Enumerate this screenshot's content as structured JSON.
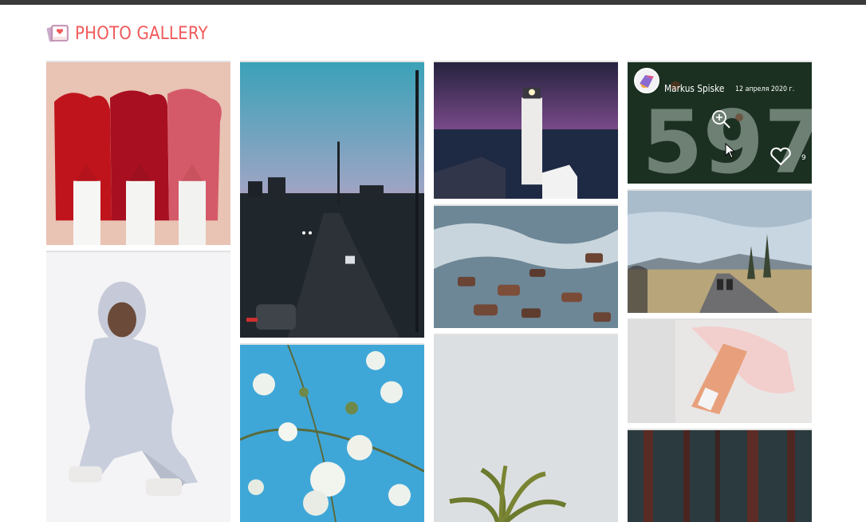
{
  "app": {
    "title": "PHOTO GALLERY",
    "logo_icon": "photo-gallery-logo-icon",
    "accent_color": "#f1595b"
  },
  "gallery": {
    "photos": [
      {
        "subject": "lipstick",
        "column": 1
      },
      {
        "subject": "man-in-grey-tracksuit",
        "column": 1
      },
      {
        "subject": "city-highway-sunset",
        "column": 2
      },
      {
        "subject": "white-blossoms",
        "column": 2
      },
      {
        "subject": "lighthouse-night",
        "column": 3
      },
      {
        "subject": "rocks-in-water",
        "column": 3
      },
      {
        "subject": "palm-tree",
        "column": 3
      },
      {
        "subject": "number-597-wall",
        "column": 4,
        "hovered": true
      },
      {
        "subject": "motorcycles-road",
        "column": 4
      },
      {
        "subject": "skincare-bottle",
        "column": 4
      },
      {
        "subject": "forest-trees",
        "column": 4
      }
    ],
    "hover_overlay": {
      "author": "Markus Spiske",
      "date": "12 апреля 2020 г.",
      "likes": "9",
      "zoom_icon": "zoom-in-icon",
      "like_icon": "heart-icon"
    }
  }
}
